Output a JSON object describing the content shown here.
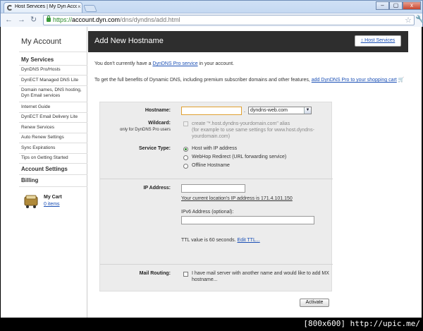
{
  "browser": {
    "tab_title": "Host Services | My Dyn Acco",
    "tab_close": "×",
    "url_scheme": "https://",
    "url_host": "account.dyn.com",
    "url_path": "/dns/dyndns/add.html",
    "back": "←",
    "forward": "→",
    "reload": "↻",
    "star": "☆",
    "wrench": "🔧",
    "minimize": "–",
    "maximize": "▢",
    "close": "x"
  },
  "sidebar": {
    "title": "My Account",
    "section_services": "My Services",
    "items": [
      "DynDNS Pro/Hosts",
      "DynECT Managed DNS Lite",
      "Domain names, DNS hosting, Dyn Email services",
      "Internet Guide",
      "DynECT Email Delivery Lite",
      "Renew Services",
      "Auto Renew Settings",
      "Sync Expirations",
      "Tips on Getting Started"
    ],
    "section_account": "Account Settings",
    "section_billing": "Billing",
    "cart_title": "My Cart",
    "cart_items": "0 items"
  },
  "main": {
    "header": "Add New Hostname",
    "host_services_link": "↕ Host Services",
    "notice_pre": "You don't currently have a ",
    "notice_link": "DynDNS Pro service",
    "notice_post": " in your account.",
    "upsell_pre": "To get the full benefits of Dynamic DNS, including premium subscriber domains and other features, ",
    "upsell_link": "add DynDNS Pro to your shopping cart",
    "upsell_icon": "🛒"
  },
  "form": {
    "hostname_label": "Hostname:",
    "hostname_value": "",
    "domain_selected": "dyndns-web.com",
    "dot": ".",
    "wildcard_label": "Wildcard:",
    "wildcard_sublabel": "only for DynDNS Pro users",
    "wildcard_text": "create \"*.host.dyndns-yourdomain.com\" alias",
    "wildcard_hint": "(for example to use same settings for www.host.dyndns-yourdomain.com)",
    "service_type_label": "Service Type:",
    "service_options": [
      "Host with IP address",
      "WebHop Redirect (URL forwarding service)",
      "Offline Hostname"
    ],
    "service_selected": 0,
    "ip_label": "IP Address:",
    "ip_value": "",
    "ip_current_link": "Your current location's IP address is 171.4.101.150",
    "ipv6_label": "IPv6 Address (optional):",
    "ipv6_value": "",
    "ttl_text": "TTL value is 60 seconds.",
    "ttl_link": "Edit TTL...",
    "mail_label": "Mail Routing:",
    "mail_text": "I have mail server with another name and would like to add MX hostname...",
    "activate_button": "Activate"
  },
  "watermark": "[800x600] http://upic.me/"
}
